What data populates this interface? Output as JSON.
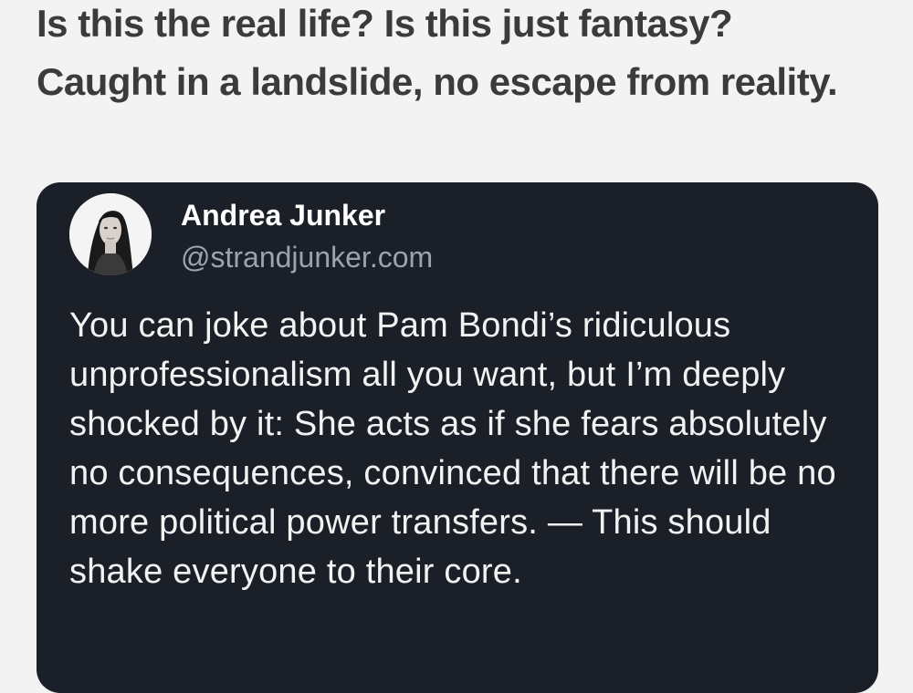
{
  "post": {
    "text": "Is this the real life? Is this just fantasy? Caught in a landslide, no escape from reality."
  },
  "quoted_post": {
    "author_name": "Andrea Junker",
    "author_handle": "@strandjunker.com",
    "avatar_icon": "user-avatar",
    "body": "You can joke about Pam Bondi’s ridiculous unprofessionalism all you want, but I’m deeply shocked by it: She acts as if she fears absolutely no consequences, convinced that there will be no more political power transfers. — This should shake everyone to their core."
  },
  "colors": {
    "page_background": "#f3f3f3",
    "card_background": "#1b1f27",
    "post_text": "#3b3b3b",
    "quote_text": "#f2f2f2",
    "handle_text": "#9aa3ae"
  }
}
